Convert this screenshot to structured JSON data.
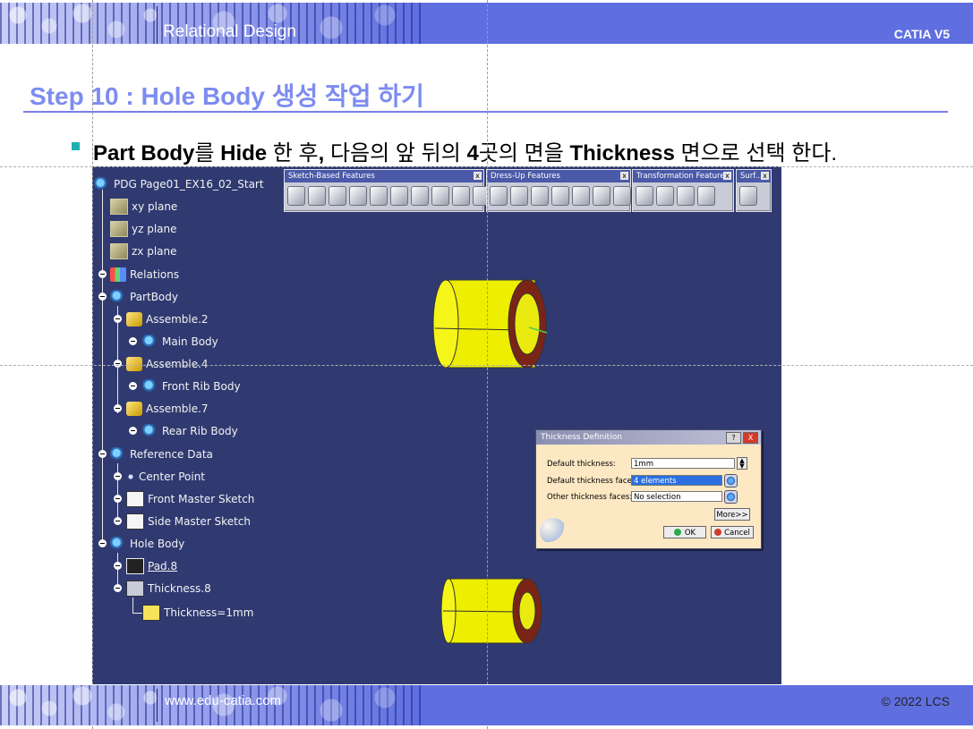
{
  "header": {
    "title": "Relational Design",
    "product": "CATIA V5"
  },
  "slide": {
    "step_title": "Step 10 : Hole Body 생성 작업 하기",
    "instruction": {
      "p1": "Part Body",
      "p2": "를 ",
      "p3": "Hide",
      "p4": " 한 후",
      "p5": ",",
      "p6": " 다음의 앞 뒤의 ",
      "p7": "4",
      "p8": "곳의 면을 ",
      "p9": "Thickness",
      "p10": " 면으로 선택 한다."
    }
  },
  "footer": {
    "url": "www.edu-catia.com",
    "copyright": "© 2022 LCS"
  },
  "tree": {
    "root": "PDG Page01_EX16_02_Start",
    "xy": "xy plane",
    "yz": "yz plane",
    "zx": "zx plane",
    "relations": "Relations",
    "partbody": "PartBody",
    "assemble2": "Assemble.2",
    "main_body": "Main Body",
    "assemble4": "Assemble.4",
    "front_rib": "Front Rib Body",
    "assemble7": "Assemble.7",
    "rear_rib": "Rear Rib Body",
    "reference": "Reference Data",
    "center_point": "Center Point",
    "front_master": "Front Master Sketch",
    "side_master": "Side Master Sketch",
    "hole_body": "Hole Body",
    "pad": "Pad.8",
    "thickness": "Thickness.8",
    "thickness_param": "Thickness=1mm"
  },
  "toolbars": {
    "sketch": "Sketch-Based Features",
    "dressup": "Dress-Up Features",
    "transform": "Transformation Features",
    "surf": "Surf...",
    "close": "x"
  },
  "dialog": {
    "title": "Thickness Definition",
    "help": "?",
    "close": "X",
    "default_thickness_label": "Default thickness:",
    "default_thickness_value": "1mm",
    "default_faces_label": "Default thickness faces:",
    "default_faces_value": "4 elements",
    "other_faces_label": "Other thickness faces:",
    "other_faces_value": "No selection",
    "more": "More>>",
    "ok": "OK",
    "cancel": "Cancel"
  },
  "colors": {
    "viewport": "#303a71",
    "part": "#f2f20a",
    "part_end": "#7a2418",
    "accent": "#7d8cf0"
  }
}
